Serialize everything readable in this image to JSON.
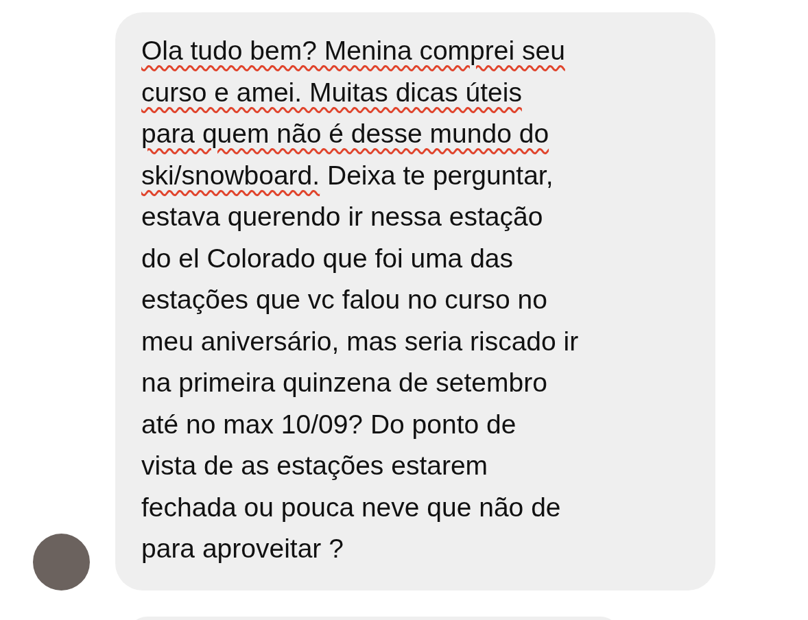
{
  "messages": [
    {
      "kind": "received",
      "underlined": "Ola tudo bem? Menina comprei seu\ncurso e amei. Muitas dicas úteis\npara quem não é desse mundo do\nski/snowboard.",
      "text": " Deixa te perguntar,\nestava querendo ir nessa estação\ndo el Colorado que foi uma das\nestações que vc falou no curso no\nmeu aniversário, mas seria riscado ir\nna primeira quinzena de setembro\naté no max 10/09? Do ponto de\nvista de as estações estarem\nfechada ou pouca neve que não de\npara aproveitar ?",
      "avatar": true
    },
    {
      "kind": "received_partial"
    }
  ]
}
